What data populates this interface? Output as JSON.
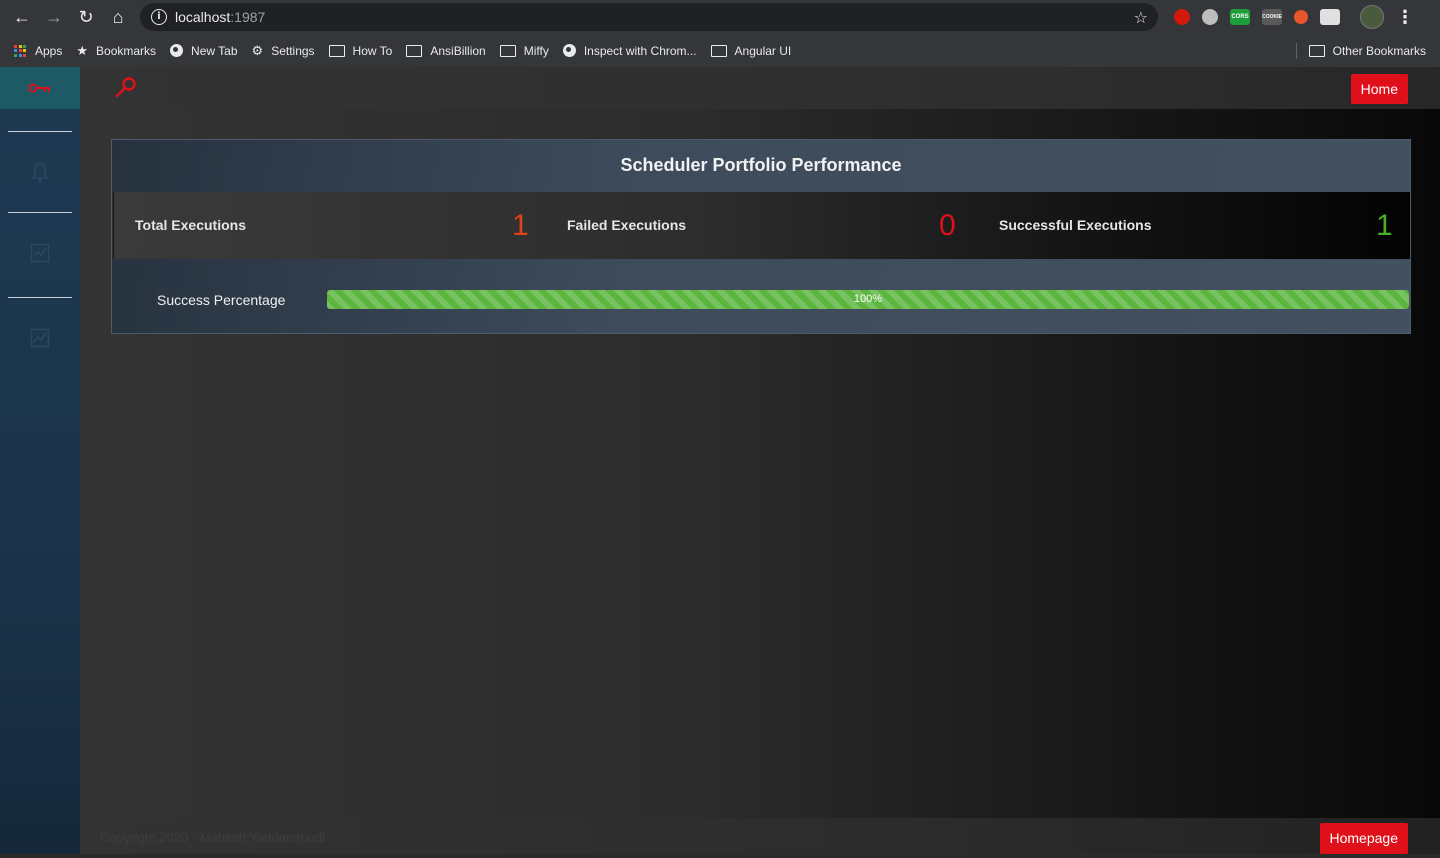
{
  "browser": {
    "url_host": "localhost",
    "url_port": ":1987",
    "bookmarks": [
      {
        "label": "Apps",
        "icon": "apps-grid-icon"
      },
      {
        "label": "Bookmarks",
        "icon": "star-icon"
      },
      {
        "label": "New Tab",
        "icon": "globe-icon"
      },
      {
        "label": "Settings",
        "icon": "gear-icon"
      },
      {
        "label": "How To",
        "icon": "folder-icon"
      },
      {
        "label": "AnsiBillion",
        "icon": "folder-icon"
      },
      {
        "label": "Miffy",
        "icon": "folder-icon"
      },
      {
        "label": "Inspect with Chrom...",
        "icon": "globe-icon"
      },
      {
        "label": "Angular UI",
        "icon": "folder-icon"
      }
    ],
    "other_bookmarks": "Other Bookmarks",
    "extensions": {
      "cors_label": "CORS",
      "cookie_label": "COOKIE"
    }
  },
  "topbar": {
    "home_label": "Home"
  },
  "panel": {
    "title": "Scheduler Portfolio Performance",
    "stats": [
      {
        "label": "Total Executions",
        "value": "1",
        "color": "#e0401a"
      },
      {
        "label": "Failed Executions",
        "value": "0",
        "color": "#e0101a"
      },
      {
        "label": "Successful Executions",
        "value": "1",
        "color": "#4caf2a"
      }
    ],
    "progress": {
      "label": "Success Percentage",
      "value": 100,
      "text": "100%"
    }
  },
  "footer": {
    "copyright": "Copyright 2020 - Mahesh Yaddanapudi",
    "homepage_label": "Homepage"
  },
  "colors": {
    "accent_red": "#e0101a",
    "progress_green": "#5bb53f"
  }
}
